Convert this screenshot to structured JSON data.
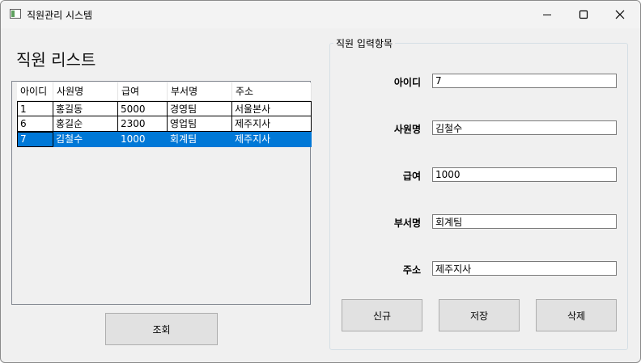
{
  "window": {
    "title": "직원관리 시스템"
  },
  "list": {
    "title": "직원 리스트",
    "columns": [
      "아이디",
      "사원명",
      "급여",
      "부서명",
      "주소"
    ],
    "rows": [
      [
        "1",
        "홍길동",
        "5000",
        "경영팀",
        "서울본사"
      ],
      [
        "6",
        "홍길순",
        "2300",
        "영업팀",
        "제주지사"
      ],
      [
        "7",
        "김철수",
        "1000",
        "회계팀",
        "제주지사"
      ]
    ],
    "selected_row": 2
  },
  "query_button": {
    "label": "조회"
  },
  "form": {
    "legend": "직원 입력항목",
    "fields": [
      {
        "label": "아이디",
        "value": "7"
      },
      {
        "label": "사원명",
        "value": "김철수"
      },
      {
        "label": "급여",
        "value": "1000"
      },
      {
        "label": "부서명",
        "value": "회계팀"
      },
      {
        "label": "주소",
        "value": "제주지사"
      }
    ],
    "buttons": {
      "new": "신규",
      "save": "저장",
      "delete": "삭제"
    }
  },
  "colors": {
    "selection": "#0078d7",
    "button_face": "#e1e1e1",
    "window_bg": "#f0f0f0"
  },
  "icons": {
    "minimize": "minimize-icon",
    "maximize": "maximize-icon",
    "close": "close-icon"
  }
}
